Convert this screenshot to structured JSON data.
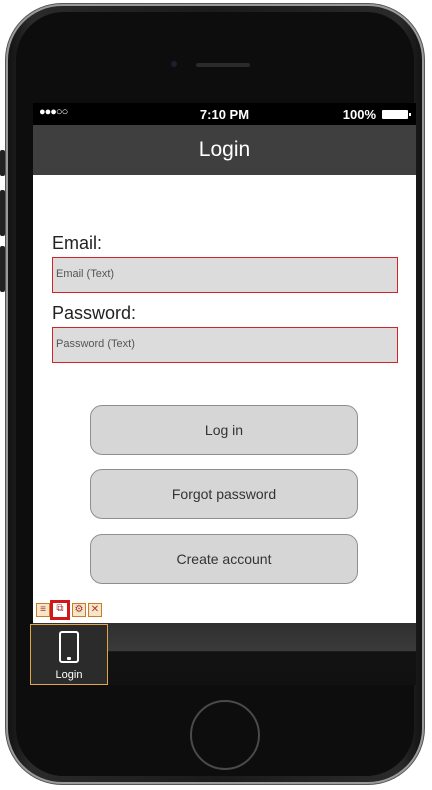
{
  "status_bar": {
    "signal": "●●●○○",
    "time": "7:10 PM",
    "battery": "100%"
  },
  "nav": {
    "title": "Login"
  },
  "form": {
    "email_label": "Email:",
    "email_placeholder": "Email (Text)",
    "password_label": "Password:",
    "password_placeholder": "Password (Text)"
  },
  "buttons": {
    "login": "Log in",
    "forgot": "Forgot password",
    "create": "Create account"
  },
  "tab": {
    "label": "Login",
    "icon": "phone-icon"
  },
  "tools": [
    "list-icon",
    "copy-icon",
    "settings-icon",
    "close-icon"
  ],
  "colors": {
    "accent_red": "#d2232a",
    "nav_bg": "#3f3f3f",
    "button_bg": "#d6d6d6"
  }
}
